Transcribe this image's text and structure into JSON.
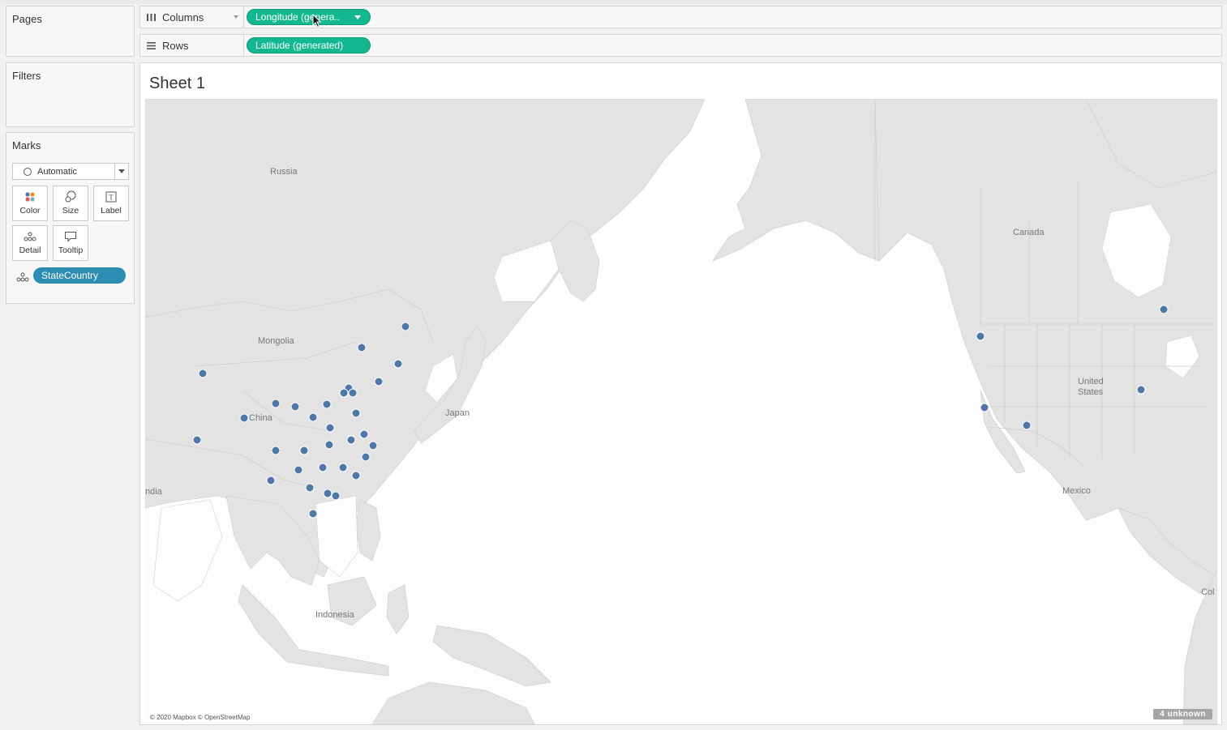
{
  "side_panel": {
    "pages_title": "Pages",
    "filters_title": "Filters",
    "marks": {
      "title": "Marks",
      "mark_type": "Automatic",
      "buttons": [
        {
          "label": "Color",
          "icon": "color-icon"
        },
        {
          "label": "Size",
          "icon": "size-icon"
        },
        {
          "label": "Label",
          "icon": "label-icon"
        },
        {
          "label": "Detail",
          "icon": "detail-icon"
        },
        {
          "label": "Tooltip",
          "icon": "tooltip-icon"
        }
      ],
      "detail_field": "StateCountry"
    }
  },
  "shelves": {
    "columns": {
      "label": "Columns",
      "pill": "Longitude (genera.."
    },
    "rows": {
      "label": "Rows",
      "pill": "Latitude (generated)"
    }
  },
  "view": {
    "sheet_title": "Sheet 1",
    "map_labels": {
      "russia": "Russia",
      "mongolia": "Mongolia",
      "china": "China",
      "japan": "Japan",
      "india": "ndia",
      "indonesia": "Indonesia",
      "canada": "Canada",
      "united_states_1": "United",
      "united_states_2": "States",
      "mexico": "Mexico",
      "colombia": "Col"
    },
    "attribution": "© 2020 Mapbox © OpenStreetMap",
    "unknown_badge": "4 unknown",
    "mark_color": "#4e79a7"
  }
}
